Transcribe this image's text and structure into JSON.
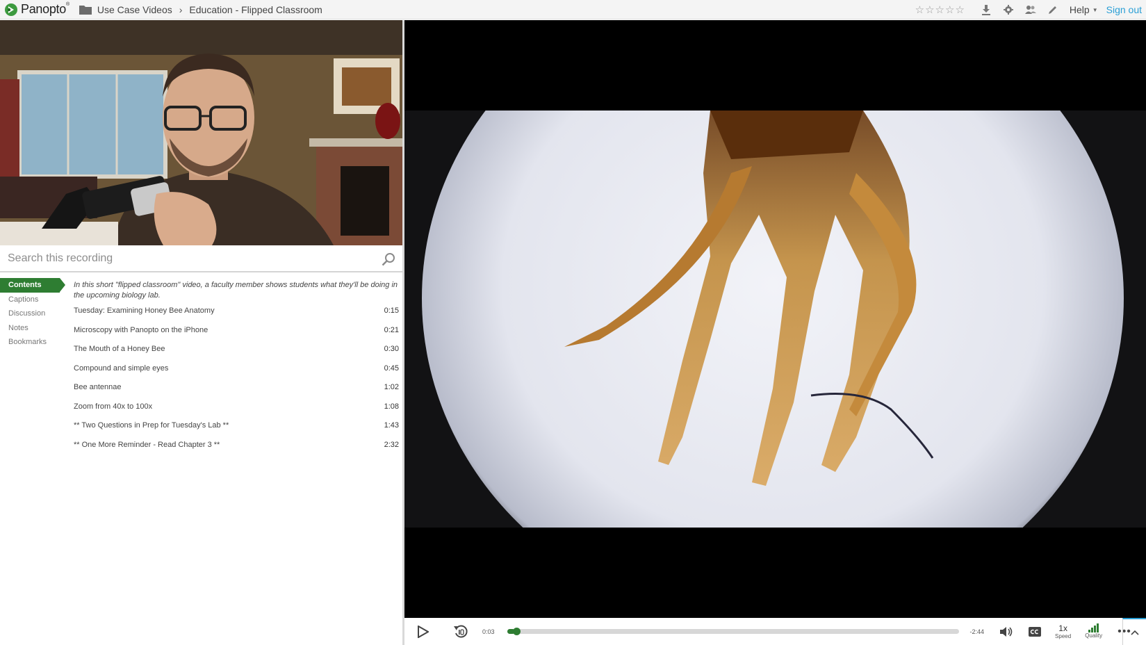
{
  "brand": {
    "name": "Panopto",
    "mark": "®"
  },
  "breadcrumb": {
    "folder": "Use Case Videos",
    "separator": "›",
    "session": "Education - Flipped Classroom"
  },
  "header": {
    "rating_stars": [
      "☆",
      "☆",
      "☆",
      "☆",
      "☆"
    ],
    "help_label": "Help",
    "signout_label": "Sign out",
    "icons": [
      "download-icon",
      "settings-icon",
      "share-icon",
      "edit-icon"
    ]
  },
  "search": {
    "placeholder": "Search this recording"
  },
  "tabs": [
    {
      "label": "Contents",
      "active": true
    },
    {
      "label": "Captions",
      "active": false
    },
    {
      "label": "Discussion",
      "active": false
    },
    {
      "label": "Notes",
      "active": false
    },
    {
      "label": "Bookmarks",
      "active": false
    }
  ],
  "contents": {
    "description": "In this short \"flipped classroom\" video, a faculty member shows students what they'll be doing in the upcoming biology lab.",
    "entries": [
      {
        "title": "Tuesday: Examining Honey Bee Anatomy",
        "time": "0:15"
      },
      {
        "title": "Microscopy with Panopto on the iPhone",
        "time": "0:21"
      },
      {
        "title": "The Mouth of a Honey Bee",
        "time": "0:30"
      },
      {
        "title": "Compound and simple eyes",
        "time": "0:45"
      },
      {
        "title": "Bee antennae",
        "time": "1:02"
      },
      {
        "title": "Zoom from 40x to 100x",
        "time": "1:08"
      },
      {
        "title": "** Two Questions in Prep for Tuesday's Lab **",
        "time": "1:43"
      },
      {
        "title": "** One More Reminder - Read Chapter 3 **",
        "time": "2:32"
      }
    ]
  },
  "player": {
    "current_time": "0:03",
    "remaining_time": "-2:44",
    "progress_fraction": 0.018,
    "speed_value": "1x",
    "speed_label": "Speed",
    "quality_label": "Quality",
    "more_label": "•••"
  },
  "colors": {
    "accent_green": "#2e7d32",
    "link_blue": "#2a9fd6"
  }
}
